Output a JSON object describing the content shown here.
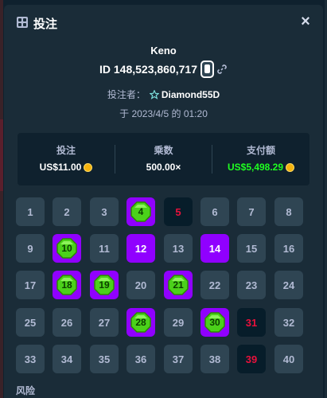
{
  "header": {
    "title": "投注",
    "close_label": "×"
  },
  "game": {
    "name": "Keno",
    "bet_id": "ID 148,523,860,717",
    "bettor_label": "投注者：",
    "bettor_name": "Diamond55D",
    "date_line": "于 2023/4/5 的 01:20"
  },
  "stats": [
    {
      "label": "投注",
      "value": "US$11.00"
    },
    {
      "label": "乘数",
      "value": "500.00×"
    },
    {
      "label": "支付额",
      "value": "US$5,498.29"
    }
  ],
  "grid": {
    "numbers": [
      "1",
      "2",
      "3",
      "4",
      "5",
      "6",
      "7",
      "8",
      "9",
      "10",
      "11",
      "12",
      "13",
      "14",
      "15",
      "16",
      "17",
      "18",
      "19",
      "20",
      "21",
      "22",
      "23",
      "24",
      "25",
      "26",
      "27",
      "28",
      "29",
      "30",
      "31",
      "32",
      "33",
      "34",
      "35",
      "36",
      "37",
      "38",
      "39",
      "40"
    ],
    "hits": [
      "4",
      "10",
      "18",
      "19",
      "21",
      "28",
      "30"
    ],
    "selected_no_hit": [
      "12",
      "14"
    ],
    "drawn_misses": [
      "5",
      "31",
      "39"
    ]
  },
  "section_label": "风险",
  "colors": {
    "background": "#0f212e",
    "panel": "#1a2c38",
    "tile": "#2f4553",
    "selected": "#9000ff",
    "gem": "#4bd11a",
    "miss_text": "#e9113c",
    "payout_green": "#1fff20",
    "coin": "#f5b30f"
  },
  "icons": {
    "header": "keno-grid-icon",
    "close": "close-icon",
    "copy": "copy-icon",
    "link": "link-icon",
    "vip": "star-icon",
    "currency": "coin-icon"
  }
}
